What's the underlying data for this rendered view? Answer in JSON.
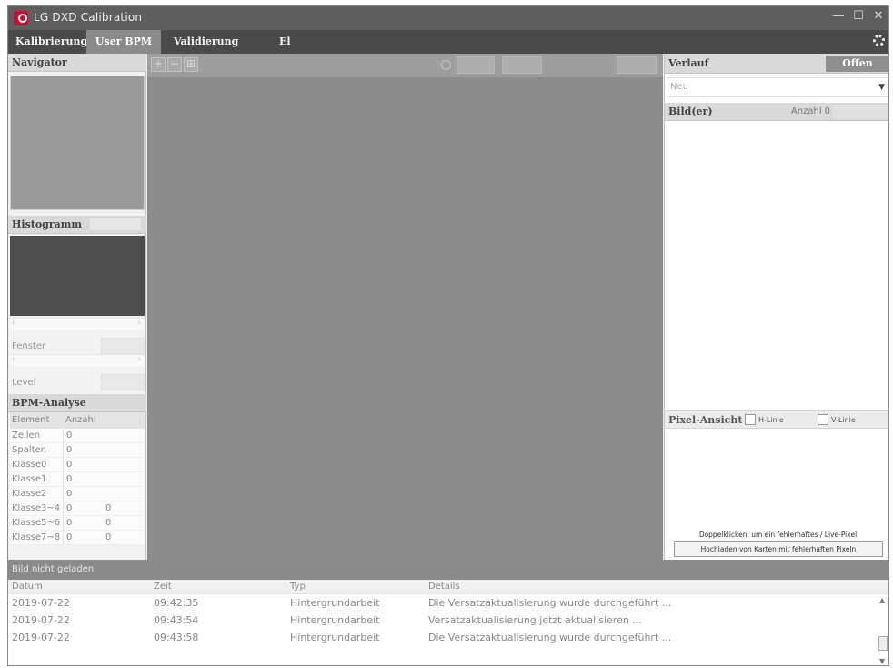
{
  "app": {
    "title": "LG DXD Calibration",
    "window_controls": {
      "minimize": "—",
      "maximize": "☐",
      "close": "✕"
    }
  },
  "tabs": [
    {
      "label": "Kalibrierung",
      "active": false
    },
    {
      "label": "User BPM",
      "active": true
    },
    {
      "label": "Validierung",
      "active": false
    },
    {
      "label": "El",
      "active": false
    }
  ],
  "left": {
    "navigator_title": "Navigator",
    "histogram_title": "Histogramm",
    "fenster_label": "Fenster",
    "level_label": "Level",
    "bpm_title": "BPM-Analyse",
    "bpm_headers": [
      "Element",
      "Anzahl"
    ],
    "bpm_rows": [
      {
        "element": "Zeilen",
        "a": "0",
        "b": ""
      },
      {
        "element": "Spalten",
        "a": "0",
        "b": ""
      },
      {
        "element": "Klasse0",
        "a": "0",
        "b": ""
      },
      {
        "element": "Klasse1",
        "a": "0",
        "b": ""
      },
      {
        "element": "Klasse2",
        "a": "0",
        "b": ""
      },
      {
        "element": "Klasse3~4",
        "a": "0",
        "b": "0"
      },
      {
        "element": "Klasse5~6",
        "a": "0",
        "b": "0"
      },
      {
        "element": "Klasse7~8",
        "a": "0",
        "b": "0"
      }
    ]
  },
  "toolbar": {
    "plus": "+",
    "minus": "−",
    "fit": "⊞"
  },
  "right": {
    "verlauf_title": "Verlauf",
    "offen_button": "Offen",
    "select_value": "Neu",
    "bilder_title": "Bild(er)",
    "anzahl_label": "Anzahl",
    "anzahl_value": "0",
    "pixel_title": "Pixel-Ansicht",
    "h_linie": "H-Linie",
    "v_linie": "V-Linie",
    "hint": "Doppelklicken, um ein fehlerhaftes / Live-Pixel",
    "upload_button": "Hochladen von Karten mit fehlerhaften Pixeln"
  },
  "status_text": "Bild nicht geladen",
  "log": {
    "headers": [
      "Datum",
      "Zeit",
      "Typ",
      "Details"
    ],
    "rows": [
      [
        "2019-07-22",
        "09:42:35",
        "Hintergrundarbeit",
        "Die Versatzaktualisierung wurde durchgeführt ..."
      ],
      [
        "2019-07-22",
        "09:43:54",
        "Hintergrundarbeit",
        "Versatzaktualisierung jetzt aktualisieren ..."
      ],
      [
        "2019-07-22",
        "09:43:58",
        "Hintergrundarbeit",
        "Die Versatzaktualisierung wurde durchgeführt ..."
      ]
    ]
  }
}
